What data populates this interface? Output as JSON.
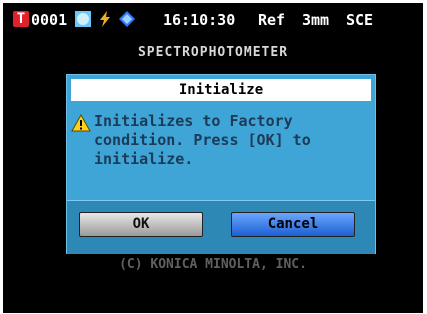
{
  "status_bar": {
    "target_icon_glyph": "T",
    "target_number": "0001",
    "icons": [
      "sphere-icon",
      "lightning-icon",
      "diamond-icon"
    ],
    "time": "16:10:30",
    "ref_label": "Ref",
    "aperture": "3mm",
    "mode": "SCE"
  },
  "background": {
    "title": "SPECTROPHOTOMETER",
    "copyright": "(C) KONICA MINOLTA, INC."
  },
  "dialog": {
    "title": "Initialize",
    "message_lines": [
      "Initializes to Factory",
      "condition. Press [OK] to",
      "initialize."
    ],
    "ok_label": "OK",
    "cancel_label": "Cancel"
  },
  "colors": {
    "dialog_bg": "#3ea5d6",
    "button_bar": "#2e88b5",
    "cancel_button": "#1c5fd2",
    "target_icon": "#e0202a"
  }
}
